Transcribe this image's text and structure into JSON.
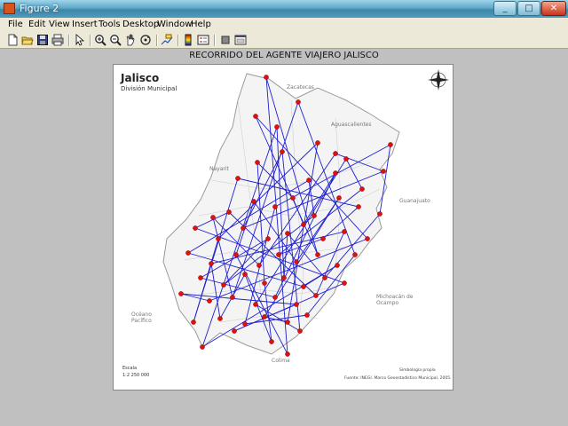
{
  "window": {
    "title": "Figure 2"
  },
  "window_controls": {
    "minimize": "_",
    "maximize": "□",
    "close": "✕"
  },
  "menubar": {
    "items": [
      "File",
      "Edit",
      "View",
      "Insert",
      "Tools",
      "Desktop",
      "Window",
      "Help"
    ]
  },
  "toolbar": {
    "tools": [
      "new-figure",
      "open-file",
      "save-figure",
      "print-figure",
      "edit-plot",
      "zoom-in",
      "zoom-out",
      "pan",
      "rotate-3d",
      "data-cursor",
      "insert-colorbar",
      "insert-legend",
      "hide-plot-tools",
      "show-plot-tools"
    ]
  },
  "plot": {
    "title": "RECORRIDO DEL AGENTE VIAJERO JALISCO"
  },
  "map": {
    "title": "Jalisco",
    "subtitle": "División Municipal",
    "labels": {
      "zacatecas": "Zacatecas",
      "aguascalientes": "Aguascalientes",
      "nayarit": "Nayarit",
      "guanajuato": "Guanajuato",
      "michoacan": "Michoacán de Ocampo",
      "oceano": "Océano Pacífico",
      "colima": "Colima"
    },
    "scale_label": "Escala",
    "scale_value": "1:2 250 000",
    "source_line1": "Simbología propia",
    "source_line2": "Fuente: INEGI. Marco Geoestadístico Municipal, 2005."
  },
  "colors": {
    "route": "#1f1fd0",
    "node": "#e01010",
    "border": "#9a9a9a"
  }
}
